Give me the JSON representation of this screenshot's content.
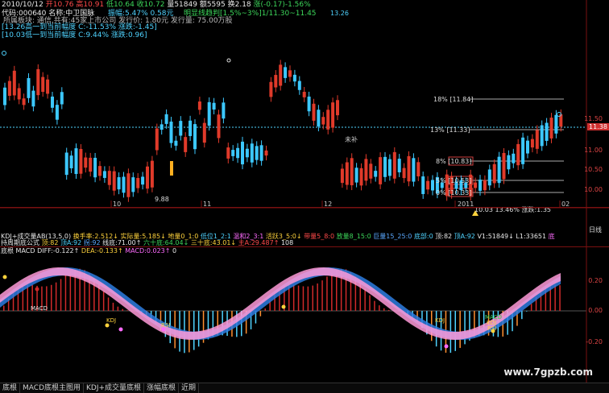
{
  "header": {
    "line1": {
      "date": "2010/10/12",
      "open": "开10.76",
      "high": "高10.91",
      "low": "低10.64",
      "close": "收10.72",
      "volume": "量51849",
      "amount": "额5595",
      "turnover": "换2.18",
      "change": "涨(-0.17)-1.56%"
    },
    "line2_left": "代码:000640 名称:中卫国脉",
    "range_label": "振幅:5.47% 0.58元",
    "trend_label": "明显线趋判[1.5%~3%]1/11.30~11.45",
    "line3": "所属板块: 通信,共有:45家上市公司  发行价: 1.80元  发行量: 75.00万股",
    "stat1": "[13.26高一到当前幅度 C:-11.53%  涨跌:-1.45]",
    "stat2": "[10.03低一到当前幅度 C:9.44%  涨跌:0.96]",
    "corner_value": "13.26"
  },
  "price_axis": {
    "labels": [
      "11.50",
      "11.38",
      "11.00",
      "10.50",
      "10.00"
    ],
    "current": "11.38"
  },
  "fib": {
    "levels": [
      "18%  [11.84]",
      "13%  [11.33]",
      "8%  [10.83]",
      "5%  [10.53]",
      "0%  [10.33]"
    ],
    "low_note": "10.03  13.46%  涨跌:1.35",
    "low_marker": "9.88",
    "mid_note": "未补"
  },
  "months": [
    "10",
    "11",
    "12",
    "2011",
    "02"
  ],
  "weekly_label": "日线",
  "indicator_row1": [
    {
      "t": "KDJ+成交量AB(13,5,0)",
      "c": "white"
    },
    {
      "t": "换手率:2.512↓",
      "c": "yellow"
    },
    {
      "t": "实际量:5.185↓",
      "c": "yellow"
    },
    {
      "t": "地量0_1:0",
      "c": "yellow"
    },
    {
      "t": "低位1_2:1",
      "c": "cyan"
    },
    {
      "t": "温和2_3:1",
      "c": "mag"
    },
    {
      "t": "活跃3_5:0↓",
      "c": "yellow"
    },
    {
      "t": "带量5_8:0",
      "c": "red"
    },
    {
      "t": "放量8_15:0",
      "c": "green"
    },
    {
      "t": "巨量15_25:0",
      "c": "blue"
    },
    {
      "t": "底部:0",
      "c": "cyan"
    },
    {
      "t": "顶:82",
      "c": "white"
    },
    {
      "t": "顶A:92",
      "c": "cyan"
    },
    {
      "t": "V1:51849↓",
      "c": "white"
    },
    {
      "t": "L1:33651",
      "c": "white"
    },
    {
      "t": "底",
      "c": "mag"
    }
  ],
  "indicator_row2": [
    {
      "t": "持周期底公式",
      "c": "white"
    },
    {
      "t": "顶:82",
      "c": "yellow"
    },
    {
      "t": "顶A:92",
      "c": "cyan"
    },
    {
      "t": "拐:92",
      "c": "blue"
    },
    {
      "t": "线底:71.00↑",
      "c": "white"
    },
    {
      "t": "六十底:64.04↓",
      "c": "green"
    },
    {
      "t": "三十底:43.01↓",
      "c": "yellow"
    },
    {
      "t": "主A:29.487↑",
      "c": "red"
    },
    {
      "t": "108",
      "c": "white"
    }
  ],
  "macd_row": [
    {
      "t": "底根 MACD DIFF:-0.122↑",
      "c": "white"
    },
    {
      "t": "DEA:-0.133↑",
      "c": "yellow"
    },
    {
      "t": "MACD:0.023↑",
      "c": "mag"
    },
    {
      "t": "0",
      "c": "white"
    }
  ],
  "macd_axis": [
    "0.20",
    "0.00",
    "-0.20"
  ],
  "macd_marks": [
    {
      "t": "MACD",
      "c": "white"
    },
    {
      "t": "KDJ",
      "c": "yellow"
    },
    {
      "t": "RSI",
      "c": "yellow"
    },
    {
      "t": "KDJ",
      "c": "yellow"
    },
    {
      "t": "MACD",
      "c": "green"
    },
    {
      "t": "KDJ",
      "c": "yellow"
    },
    {
      "t": "RSI",
      "c": "yellow"
    }
  ],
  "watermark": "www.7gpzb.com",
  "tabs": [
    "底根",
    "MACD底根主图用",
    "KDJ+成交量底根",
    "涨幅底根",
    "近期"
  ]
}
